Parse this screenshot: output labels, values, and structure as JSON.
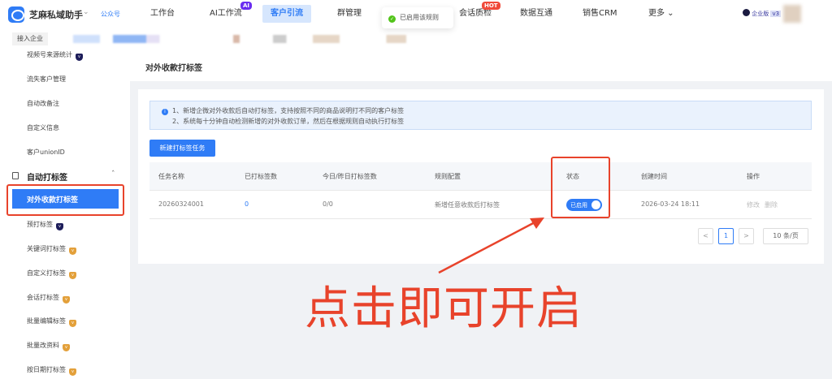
{
  "header": {
    "brand": "芝麻私域助手",
    "account_type": "公众号",
    "nav": [
      {
        "label": "工作台"
      },
      {
        "label": "AI工作流",
        "badge": "AI"
      },
      {
        "label": "客户引流",
        "active": true
      },
      {
        "label": "群管理"
      },
      {
        "label": "会话质检",
        "badge": "HOT"
      },
      {
        "label": "数据互通"
      },
      {
        "label": "销售CRM"
      },
      {
        "label": "更多"
      }
    ],
    "edition": "企业版",
    "version": "v3"
  },
  "toast": {
    "text": "已启用该规则",
    "icon": "check-circle-icon"
  },
  "subbar": {
    "join_label": "接入企业"
  },
  "sidebar": {
    "items": [
      {
        "label": "视频号来源统计",
        "gem": "dark"
      },
      {
        "label": "流失客户管理"
      },
      {
        "label": "自动改备注"
      },
      {
        "label": "自定义信息"
      },
      {
        "label": "客户unionID"
      }
    ],
    "group": {
      "label": "自动打标签"
    },
    "selected": "对外收款打标签",
    "sub_items": [
      {
        "label": "预打标签",
        "gem": "dark"
      },
      {
        "label": "关键词打标签",
        "gem": "gold"
      },
      {
        "label": "自定义打标签",
        "gem": "gold"
      },
      {
        "label": "会话打标签",
        "gem": "gold"
      },
      {
        "label": "批量编辑标签",
        "gem": "gold"
      },
      {
        "label": "批量改资料",
        "gem": "gold"
      },
      {
        "label": "按日期打标签",
        "gem": "gold"
      }
    ]
  },
  "page": {
    "title": "对外收款打标签",
    "notice": [
      "1、新增企微对外收款后自动打标签，支持按照不同的商品说明打不同的客户标签",
      "2、系统每十分钟自动检测新增的对外收款订单，然后在根据规则自动执行打标签"
    ],
    "new_button": "新建打标签任务",
    "table": {
      "columns": [
        "任务名称",
        "已打标签数",
        "今日/昨日打标签数",
        "规则配置",
        "状态",
        "创建时间",
        "操作"
      ],
      "rows": [
        {
          "name": "20260324001",
          "tagged": "0",
          "today_yesterday": "0/0",
          "rule": "新增任意收款后打标签",
          "status": "已启用",
          "status_on": true,
          "created": "2026-03-24 18:11",
          "edit": "修改",
          "delete": "删除"
        }
      ]
    },
    "pagination": {
      "prev": "<",
      "current": "1",
      "next": ">",
      "page_size": "10 条/页"
    }
  },
  "annotation": {
    "text": "点击即可开启",
    "color": "#e8432b"
  },
  "colors": {
    "primary": "#2f7cf6",
    "annotation": "#e8432b"
  }
}
